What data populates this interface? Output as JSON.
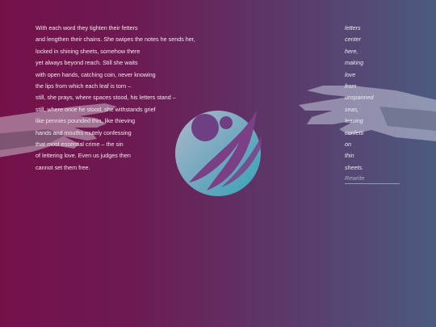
{
  "poem": {
    "lines": [
      "With each word they tighten their fetters",
      "and lengthen their chains. She swipes the notes he sends her,",
      "locked in shining sheets, somehow there",
      "yet always beyond reach. Still she waits",
      "with open hands, catching coin, never knowing",
      "the lips from which each leaf is torn –",
      "still, she prays, where spaces stood, his letters stand –",
      "still, where once he stood, she withstands grief",
      "like pennies pounded thin, like thieving",
      "hands and mouths mutely confessing",
      "that most essential crime – the sin",
      "of lettering love. Even us judges then",
      "cannot set them free."
    ]
  },
  "words": [
    "letters",
    "center",
    "here,",
    "making",
    "love",
    "from",
    "unspanned",
    "seas,",
    "leaving",
    "confetti",
    "on",
    "thin",
    "sheets."
  ],
  "rewrite_label": "Rewrite",
  "colors": {
    "bg_left": "#74114a",
    "bg_right": "#4c5a80",
    "logo_teal": "#36b3c2",
    "logo_purple": "#7b3f86"
  },
  "icons": {
    "logo": "circle-swirl-logo",
    "left_hand": "reaching-hand",
    "right_hand": "reaching-hand"
  }
}
